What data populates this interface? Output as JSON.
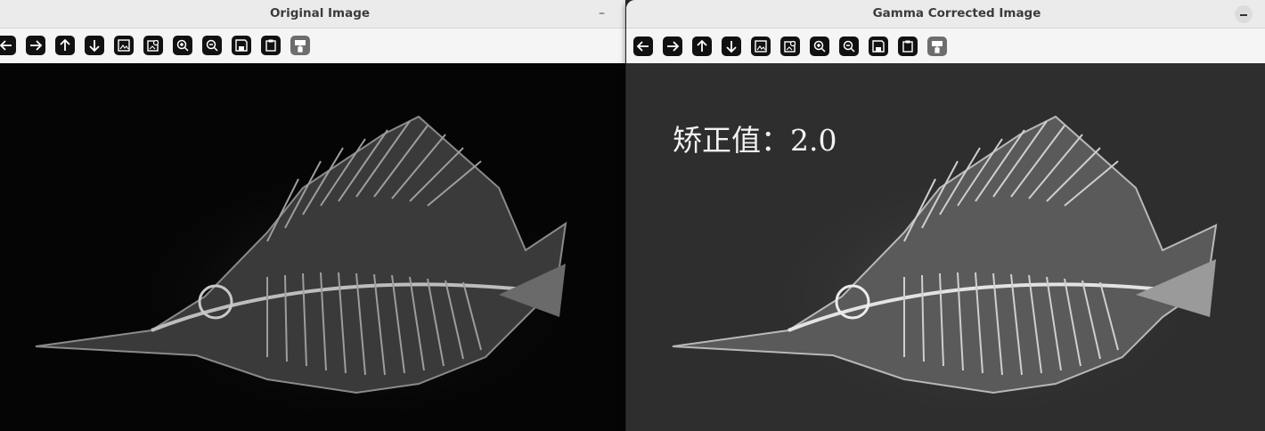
{
  "windows": {
    "left": {
      "title": "Original Image",
      "minimize_label": "–"
    },
    "right": {
      "title": "Gamma Corrected Image",
      "overlay_text": "矫正值：2.0"
    }
  },
  "toolbar": {
    "buttons": [
      {
        "name": "pan-left",
        "icon": "arrow-left-icon"
      },
      {
        "name": "pan-right",
        "icon": "arrow-right-icon"
      },
      {
        "name": "pan-up",
        "icon": "arrow-up-icon"
      },
      {
        "name": "pan-down",
        "icon": "arrow-down-icon"
      },
      {
        "name": "zoom-fit",
        "icon": "image-icon"
      },
      {
        "name": "zoom-original",
        "icon": "image-search-icon"
      },
      {
        "name": "zoom-in",
        "icon": "zoom-in-icon"
      },
      {
        "name": "zoom-out",
        "icon": "zoom-out-icon"
      },
      {
        "name": "save",
        "icon": "save-icon"
      },
      {
        "name": "copy",
        "icon": "clipboard-icon"
      },
      {
        "name": "properties",
        "icon": "paint-roller-icon"
      }
    ]
  },
  "colors": {
    "original_bg": "#050505",
    "corrected_bg": "#2e2e2e",
    "bone_original": "#b5b5b5",
    "bone_corrected": "#e0e0e0"
  }
}
